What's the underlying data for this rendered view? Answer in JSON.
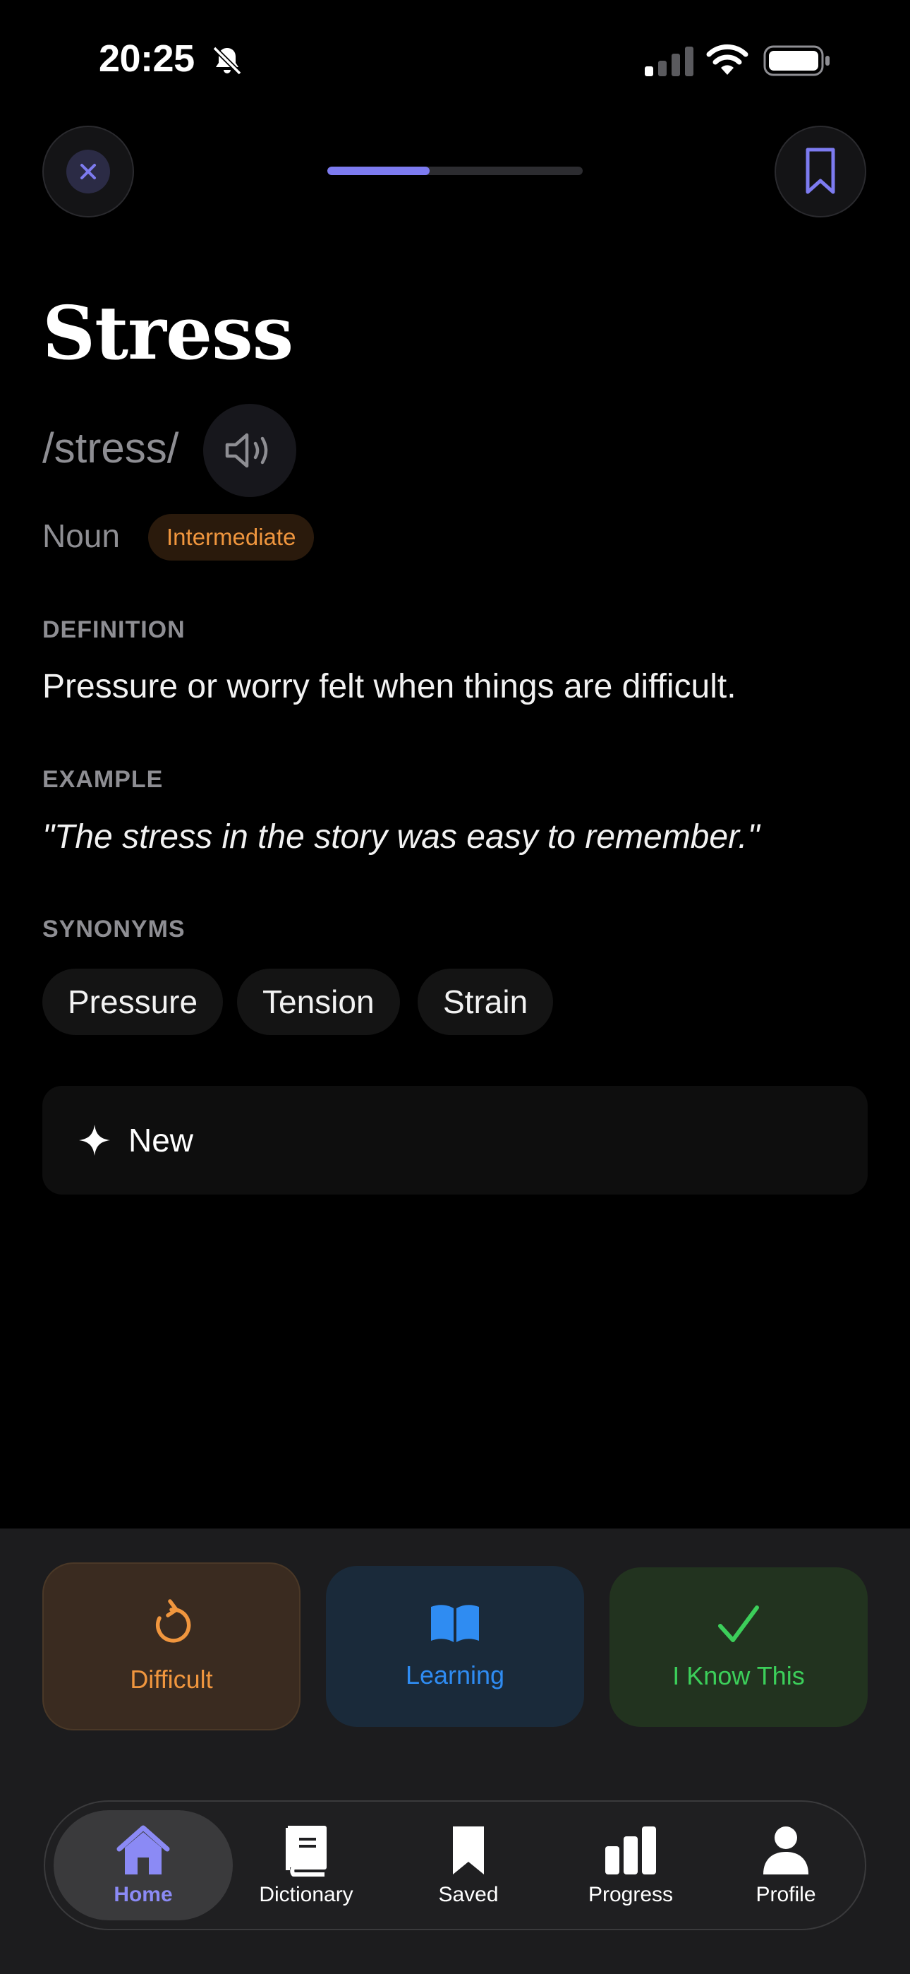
{
  "status_bar": {
    "time": "20:25",
    "icons": [
      "bell-slash-icon",
      "cellular-signal-icon",
      "wifi-icon",
      "battery-icon"
    ]
  },
  "header": {
    "close_icon": "close-icon",
    "bookmark_icon": "bookmark-icon",
    "progress_fraction": 0.4
  },
  "word": {
    "term": "Stress",
    "phonetic": "/stress/",
    "speaker_icon": "speaker-icon",
    "part_of_speech": "Noun",
    "level": "Intermediate"
  },
  "definition": {
    "label": "DEFINITION",
    "text": "Pressure or worry felt when things are difficult."
  },
  "example": {
    "label": "EXAMPLE",
    "text": "\"The stress in the story was easy to remember.\""
  },
  "synonyms": {
    "label": "SYNONYMS",
    "items": [
      "Pressure",
      "Tension",
      "Strain"
    ]
  },
  "status_card": {
    "icon": "sparkle-icon",
    "text": "New"
  },
  "actions": {
    "difficult": {
      "label": "Difficult",
      "icon": "retry-icon"
    },
    "learning": {
      "label": "Learning",
      "icon": "open-book-icon"
    },
    "know": {
      "label": "I Know This",
      "icon": "checkmark-icon"
    }
  },
  "tabbar": {
    "items": [
      {
        "label": "Home",
        "icon": "home-icon",
        "selected": true
      },
      {
        "label": "Dictionary",
        "icon": "dictionary-icon"
      },
      {
        "label": "Saved",
        "icon": "bookmark-icon"
      },
      {
        "label": "Progress",
        "icon": "bar-chart-icon"
      },
      {
        "label": "Profile",
        "icon": "person-icon"
      }
    ]
  },
  "colors": {
    "accent": "#7d7bf0",
    "difficult": "#f0963e",
    "learning": "#2f8cf2",
    "know": "#3ccf5a"
  }
}
